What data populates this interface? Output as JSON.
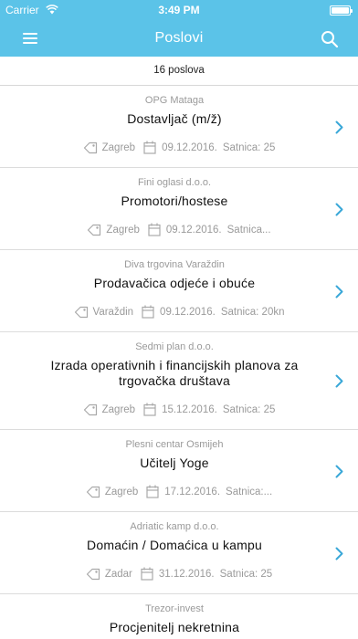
{
  "status": {
    "carrier": "Carrier",
    "time": "3:49 PM"
  },
  "nav": {
    "title": "Poslovi"
  },
  "summary": {
    "count_text": "16 poslova"
  },
  "jobs": [
    {
      "company": "OPG Mataga",
      "title": "Dostavljač (m/ž)",
      "location": "Zagreb",
      "date": "09.12.2016.",
      "rate": "Satnica: 25"
    },
    {
      "company": "Fini oglasi d.o.o.",
      "title": "Promotori/hostese",
      "location": "Zagreb",
      "date": "09.12.2016.",
      "rate": "Satnica..."
    },
    {
      "company": "Diva trgovina Varaždin",
      "title": "Prodavačica odjeće i obuće",
      "location": "Varaždin",
      "date": "09.12.2016.",
      "rate": "Satnica: 20kn"
    },
    {
      "company": "Sedmi plan d.o.o.",
      "title": "Izrada operativnih i financijskih planova za trgovačka društava",
      "location": "Zagreb",
      "date": "15.12.2016.",
      "rate": "Satnica: 25"
    },
    {
      "company": "Plesni centar Osmijeh",
      "title": "Učitelj Yoge",
      "location": "Zagreb",
      "date": "17.12.2016.",
      "rate": "Satnica:..."
    },
    {
      "company": "Adriatic kamp d.o.o.",
      "title": "Domaćin / Domaćica u kampu",
      "location": "Zadar",
      "date": "31.12.2016.",
      "rate": "Satnica: 25"
    },
    {
      "company": "Trezor-invest",
      "title": "Procjenitelj nekretnina",
      "location": "",
      "date": "",
      "rate": ""
    }
  ],
  "colors": {
    "accent": "#5bc3e8",
    "muted": "#9a9a9a",
    "chevron": "#3aa8d8"
  }
}
